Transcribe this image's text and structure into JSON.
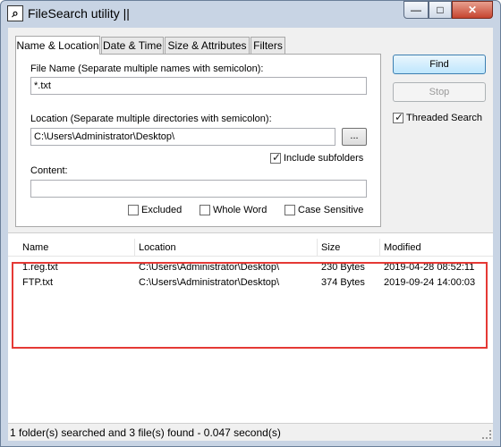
{
  "window": {
    "title": "FileSearch utility ||",
    "minimize": "—",
    "maximize": "□",
    "close": "✕"
  },
  "tabs": [
    {
      "label": "Name & Location",
      "active": true
    },
    {
      "label": "Date & Time"
    },
    {
      "label": "Size & Attributes"
    },
    {
      "label": "Filters"
    }
  ],
  "name_location": {
    "file_name_label": "File Name (Separate multiple names with semicolon):",
    "file_name_value": "*.txt",
    "location_label": "Location (Separate multiple directories with semicolon):",
    "location_value": "C:\\Users\\Administrator\\Desktop\\",
    "browse_label": "...",
    "include_subfolders_label": "Include subfolders",
    "include_subfolders_checked": true,
    "content_label": "Content:",
    "content_value": "",
    "excluded_label": "Excluded",
    "whole_word_label": "Whole Word",
    "case_sensitive_label": "Case Sensitive"
  },
  "actions": {
    "find_label": "Find",
    "stop_label": "Stop",
    "threaded_search_label": "Threaded Search",
    "threaded_search_checked": true
  },
  "results": {
    "columns": [
      "Name",
      "Location",
      "Size",
      "Modified"
    ],
    "rows": [
      {
        "name": "1.reg.txt",
        "location": "C:\\Users\\Administrator\\Desktop\\",
        "size": "230 Bytes",
        "modified": "2019-04-28 08:52:11"
      },
      {
        "name": "FTP.txt",
        "location": "C:\\Users\\Administrator\\Desktop\\",
        "size": "374 Bytes",
        "modified": "2019-09-24 14:00:03"
      }
    ]
  },
  "status": {
    "text": "1 folder(s) searched and 3 file(s) found - 0.047 second(s)"
  },
  "colors": {
    "highlight_border": "#e53935",
    "close_button": "#c5442f"
  }
}
